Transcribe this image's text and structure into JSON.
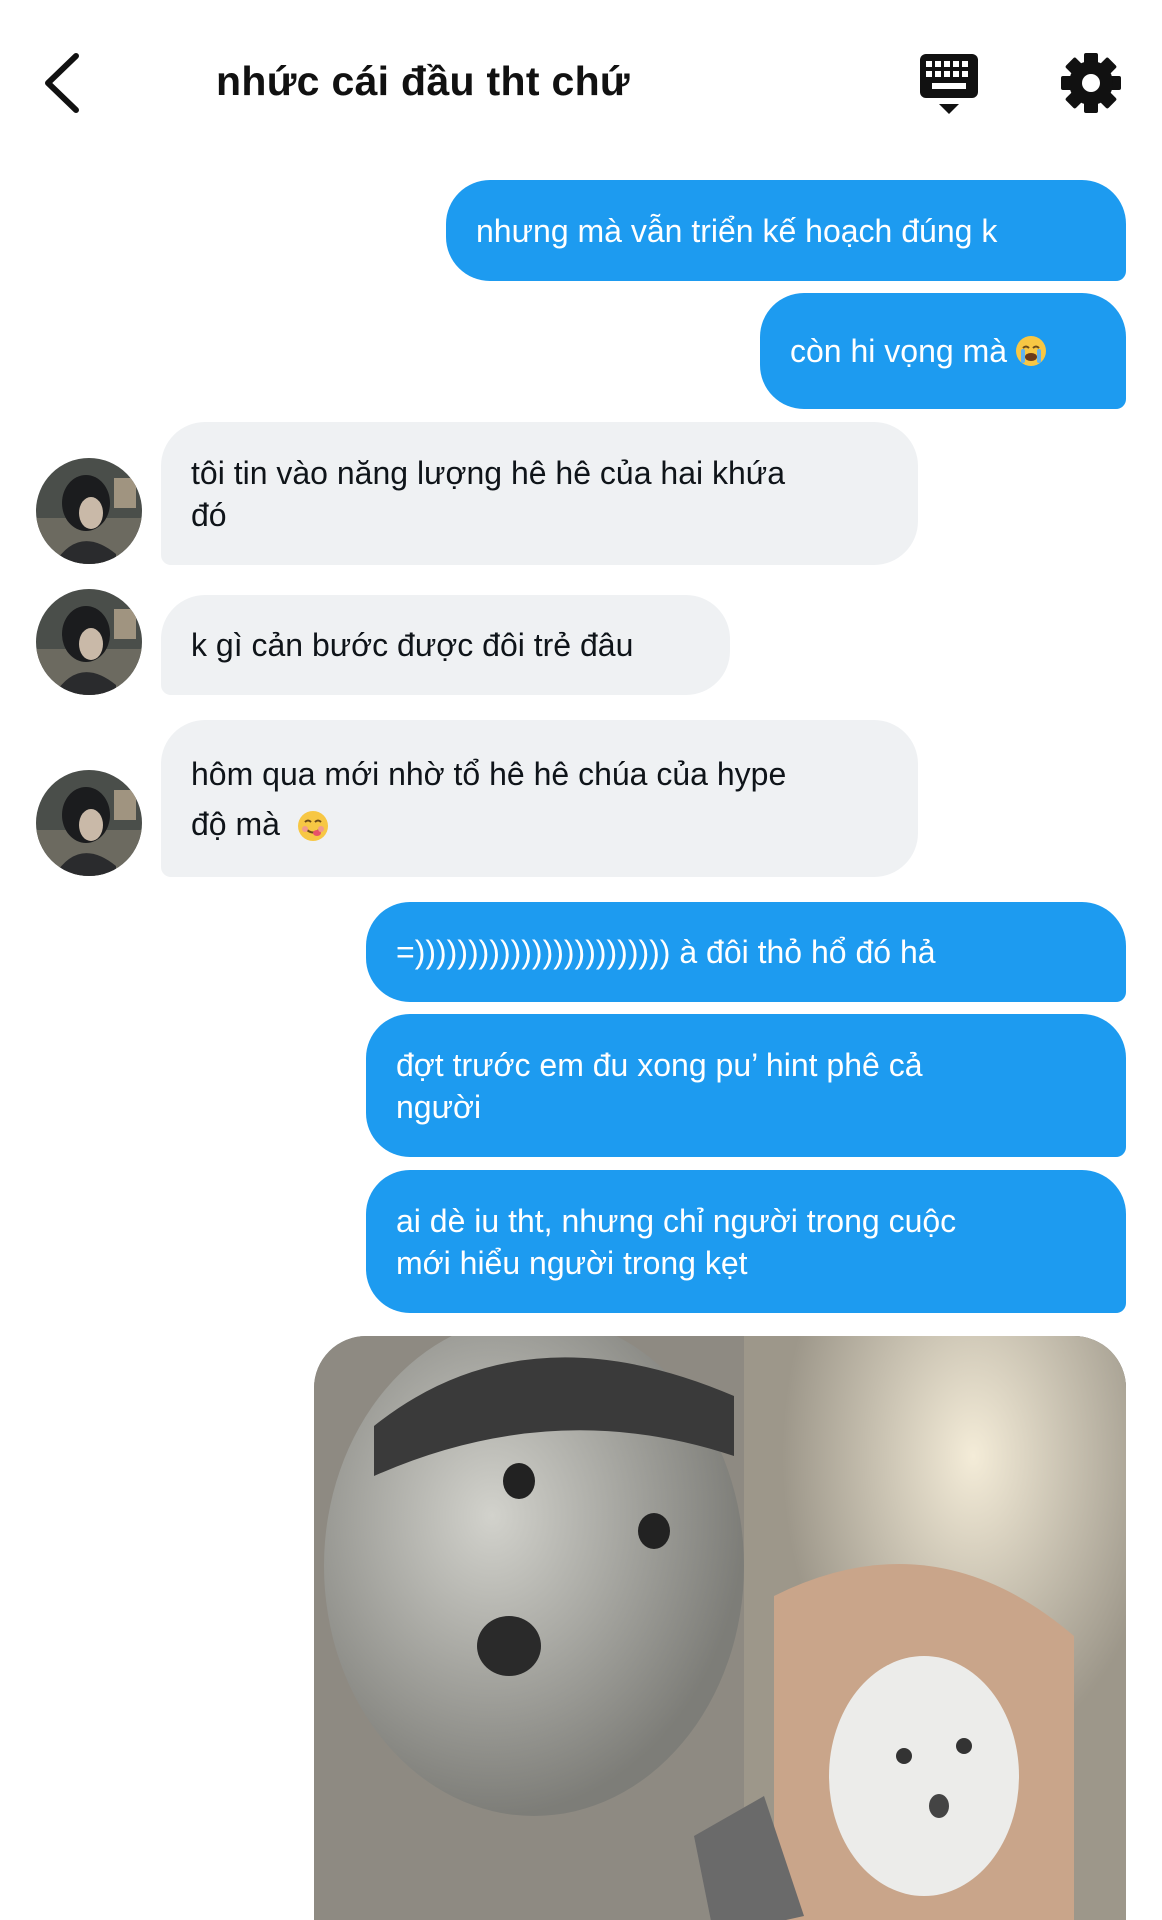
{
  "header": {
    "title": "nhức cái đầu tht chứ",
    "back_icon": "chevron-left-icon",
    "keyboard_icon": "keyboard-icon",
    "settings_icon": "gear-icon"
  },
  "colors": {
    "outgoing": "#1d9bf0",
    "incoming": "#eff1f3",
    "text_dark": "#0f1419"
  },
  "messages": [
    {
      "direction": "out",
      "text": "nhưng mà vẫn triển kế hoạch đúng k"
    },
    {
      "direction": "out",
      "text": "còn hi vọng mà",
      "emoji": "crying-face"
    },
    {
      "direction": "in",
      "line1": "tôi tin vào năng lượng hê hê của hai khứa",
      "line2": "đó"
    },
    {
      "direction": "in",
      "text": "k gì cản bước được đôi trẻ đâu"
    },
    {
      "direction": "in",
      "line1": "hôm qua mới nhờ tổ hê hê chúa của hype",
      "line2": "độ mà",
      "emoji": "yum-face"
    },
    {
      "direction": "out",
      "text": "=)))))))))))))))))))))))) à đôi thỏ hổ đó hả"
    },
    {
      "direction": "out",
      "line1": "đợt trước em đu xong pu’ hint phê cả",
      "line2": "người"
    },
    {
      "direction": "out",
      "line1": "ai dè iu tht, nhưng chỉ người trong cuộc",
      "line2": "mới hiểu người trong kẹt"
    },
    {
      "direction": "out",
      "type": "image",
      "subject": "meme-photo"
    }
  ]
}
